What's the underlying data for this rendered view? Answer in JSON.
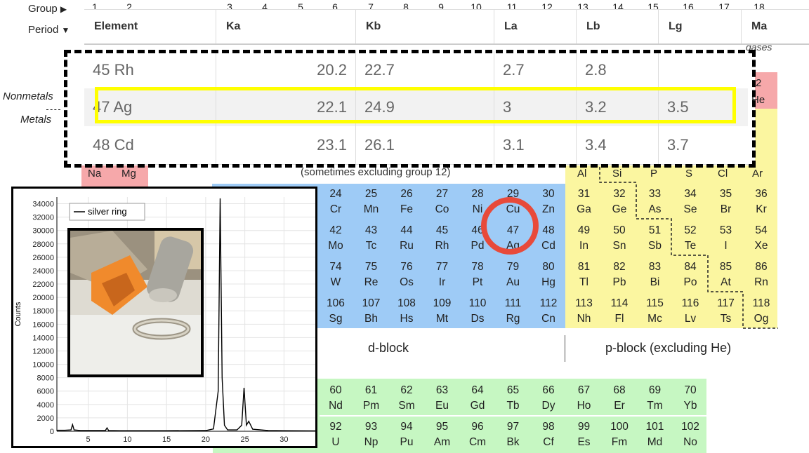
{
  "table_controls": {
    "group_label": "Group",
    "group_arrow": "▶",
    "period_label": "Period",
    "period_arrow": "▼"
  },
  "group_numbers": [
    "1",
    "2",
    "3",
    "4",
    "5",
    "6",
    "7",
    "8",
    "9",
    "10",
    "11",
    "12",
    "13",
    "14",
    "15",
    "16",
    "17",
    "18"
  ],
  "side_labels": {
    "nonmetals": "Nonmetals",
    "metals": "Metals",
    "gases": "gases"
  },
  "block_labels": {
    "d_block": "d-block",
    "p_block": "p-block (excluding He)",
    "excl_12": "(sometimes excluding group 12)"
  },
  "elements": [
    {
      "n": "24",
      "s": "Cr",
      "c": "blue"
    },
    {
      "n": "25",
      "s": "Mn",
      "c": "blue"
    },
    {
      "n": "26",
      "s": "Fe",
      "c": "blue"
    },
    {
      "n": "27",
      "s": "Co",
      "c": "blue"
    },
    {
      "n": "28",
      "s": "Ni",
      "c": "blue"
    },
    {
      "n": "29",
      "s": "Cu",
      "c": "blue"
    },
    {
      "n": "30",
      "s": "Zn",
      "c": "blue"
    },
    {
      "n": "31",
      "s": "Ga",
      "c": "yellow"
    },
    {
      "n": "32",
      "s": "Ge",
      "c": "yellow"
    },
    {
      "n": "33",
      "s": "As",
      "c": "yellow"
    },
    {
      "n": "34",
      "s": "Se",
      "c": "yellow"
    },
    {
      "n": "35",
      "s": "Br",
      "c": "yellow"
    },
    {
      "n": "36",
      "s": "Kr",
      "c": "yellow"
    },
    {
      "n": "42",
      "s": "Mo",
      "c": "blue"
    },
    {
      "n": "43",
      "s": "Tc",
      "c": "blue"
    },
    {
      "n": "44",
      "s": "Ru",
      "c": "blue"
    },
    {
      "n": "45",
      "s": "Rh",
      "c": "blue"
    },
    {
      "n": "46",
      "s": "Pd",
      "c": "blue"
    },
    {
      "n": "47",
      "s": "Ag",
      "c": "blue"
    },
    {
      "n": "48",
      "s": "Cd",
      "c": "blue"
    },
    {
      "n": "49",
      "s": "In",
      "c": "yellow"
    },
    {
      "n": "50",
      "s": "Sn",
      "c": "yellow"
    },
    {
      "n": "51",
      "s": "Sb",
      "c": "yellow"
    },
    {
      "n": "52",
      "s": "Te",
      "c": "yellow"
    },
    {
      "n": "53",
      "s": "I",
      "c": "yellow"
    },
    {
      "n": "54",
      "s": "Xe",
      "c": "yellow"
    },
    {
      "n": "74",
      "s": "W",
      "c": "blue"
    },
    {
      "n": "75",
      "s": "Re",
      "c": "blue"
    },
    {
      "n": "76",
      "s": "Os",
      "c": "blue"
    },
    {
      "n": "77",
      "s": "Ir",
      "c": "blue"
    },
    {
      "n": "78",
      "s": "Pt",
      "c": "blue"
    },
    {
      "n": "79",
      "s": "Au",
      "c": "blue"
    },
    {
      "n": "80",
      "s": "Hg",
      "c": "blue"
    },
    {
      "n": "81",
      "s": "Tl",
      "c": "yellow"
    },
    {
      "n": "82",
      "s": "Pb",
      "c": "yellow"
    },
    {
      "n": "83",
      "s": "Bi",
      "c": "yellow"
    },
    {
      "n": "84",
      "s": "Po",
      "c": "yellow"
    },
    {
      "n": "85",
      "s": "At",
      "c": "yellow"
    },
    {
      "n": "86",
      "s": "Rn",
      "c": "yellow"
    },
    {
      "n": "106",
      "s": "Sg",
      "c": "blue"
    },
    {
      "n": "107",
      "s": "Bh",
      "c": "blue"
    },
    {
      "n": "108",
      "s": "Hs",
      "c": "blue"
    },
    {
      "n": "109",
      "s": "Mt",
      "c": "blue"
    },
    {
      "n": "110",
      "s": "Ds",
      "c": "blue"
    },
    {
      "n": "111",
      "s": "Rg",
      "c": "blue"
    },
    {
      "n": "112",
      "s": "Cn",
      "c": "blue"
    },
    {
      "n": "113",
      "s": "Nh",
      "c": "yellow"
    },
    {
      "n": "114",
      "s": "Fl",
      "c": "yellow"
    },
    {
      "n": "115",
      "s": "Mc",
      "c": "yellow"
    },
    {
      "n": "116",
      "s": "Lv",
      "c": "yellow"
    },
    {
      "n": "117",
      "s": "Ts",
      "c": "yellow"
    },
    {
      "n": "118",
      "s": "Og",
      "c": "yellow"
    },
    {
      "n": "60",
      "s": "Nd",
      "c": "green"
    },
    {
      "n": "61",
      "s": "Pm",
      "c": "green"
    },
    {
      "n": "62",
      "s": "Sm",
      "c": "green"
    },
    {
      "n": "63",
      "s": "Eu",
      "c": "green"
    },
    {
      "n": "64",
      "s": "Gd",
      "c": "green"
    },
    {
      "n": "65",
      "s": "Tb",
      "c": "green"
    },
    {
      "n": "66",
      "s": "Dy",
      "c": "green"
    },
    {
      "n": "67",
      "s": "Ho",
      "c": "green"
    },
    {
      "n": "68",
      "s": "Er",
      "c": "green"
    },
    {
      "n": "69",
      "s": "Tm",
      "c": "green"
    },
    {
      "n": "70",
      "s": "Yb",
      "c": "green"
    },
    {
      "n": "92",
      "s": "U",
      "c": "green"
    },
    {
      "n": "93",
      "s": "Np",
      "c": "green"
    },
    {
      "n": "94",
      "s": "Pu",
      "c": "green"
    },
    {
      "n": "95",
      "s": "Am",
      "c": "green"
    },
    {
      "n": "96",
      "s": "Cm",
      "c": "green"
    },
    {
      "n": "97",
      "s": "Bk",
      "c": "green"
    },
    {
      "n": "98",
      "s": "Cf",
      "c": "green"
    },
    {
      "n": "99",
      "s": "Es",
      "c": "green"
    },
    {
      "n": "100",
      "s": "Fm",
      "c": "green"
    },
    {
      "n": "101",
      "s": "Md",
      "c": "green"
    },
    {
      "n": "102",
      "s": "No",
      "c": "green"
    }
  ],
  "partial_cells": {
    "na": "Na",
    "mg": "Mg",
    "al": "Al",
    "si": "Si",
    "p": "P",
    "s": "S",
    "cl": "Cl",
    "ar": "Ar",
    "he_n": "2",
    "he_s": "He"
  },
  "xray_table": {
    "headers": [
      "Element",
      "Ka",
      "Kb",
      "La",
      "Lb",
      "Lg",
      "Ma"
    ],
    "rows": [
      {
        "element": "45 Rh",
        "ka": "20.2",
        "kb": "22.7",
        "la": "2.7",
        "lb": "2.8",
        "lg": ""
      },
      {
        "element": "47 Ag",
        "ka": "22.1",
        "kb": "24.9",
        "la": "3",
        "lb": "3.2",
        "lg": "3.5"
      },
      {
        "element": "48 Cd",
        "ka": "23.1",
        "kb": "26.1",
        "la": "3.1",
        "lb": "3.4",
        "lg": "3.7"
      }
    ]
  },
  "colors": {
    "highlight": "#ffff00",
    "ring": "#e84a3a",
    "d_block": "#9ecbf6",
    "p_block": "#fbf6a0",
    "f_block": "#c6f7c2",
    "s_block": "#f6a8aa"
  },
  "chart_data": {
    "type": "line",
    "ylabel": "Counts",
    "xlabel": "",
    "legend": "silver ring",
    "xlim": [
      1,
      34
    ],
    "ylim": [
      0,
      35000
    ],
    "xticks": [
      5,
      10,
      15,
      20,
      25,
      30
    ],
    "yticks": [
      0,
      2000,
      4000,
      6000,
      8000,
      10000,
      12000,
      14000,
      16000,
      18000,
      20000,
      22000,
      24000,
      26000,
      28000,
      30000,
      32000,
      34000
    ],
    "series": [
      {
        "name": "silver ring",
        "x": [
          1,
          2,
          2.8,
          3.0,
          3.2,
          4,
          6,
          7.2,
          7.4,
          7.6,
          9,
          15,
          20,
          21,
          21.6,
          21.85,
          22.1,
          22.4,
          22.8,
          24,
          24.6,
          24.9,
          25.2,
          25.5,
          26,
          28,
          30,
          34
        ],
        "y": [
          150,
          150,
          200,
          1000,
          200,
          120,
          100,
          120,
          500,
          120,
          80,
          80,
          100,
          350,
          6000,
          34800,
          8000,
          900,
          200,
          200,
          900,
          6500,
          900,
          1500,
          300,
          120,
          80,
          50
        ]
      }
    ]
  }
}
